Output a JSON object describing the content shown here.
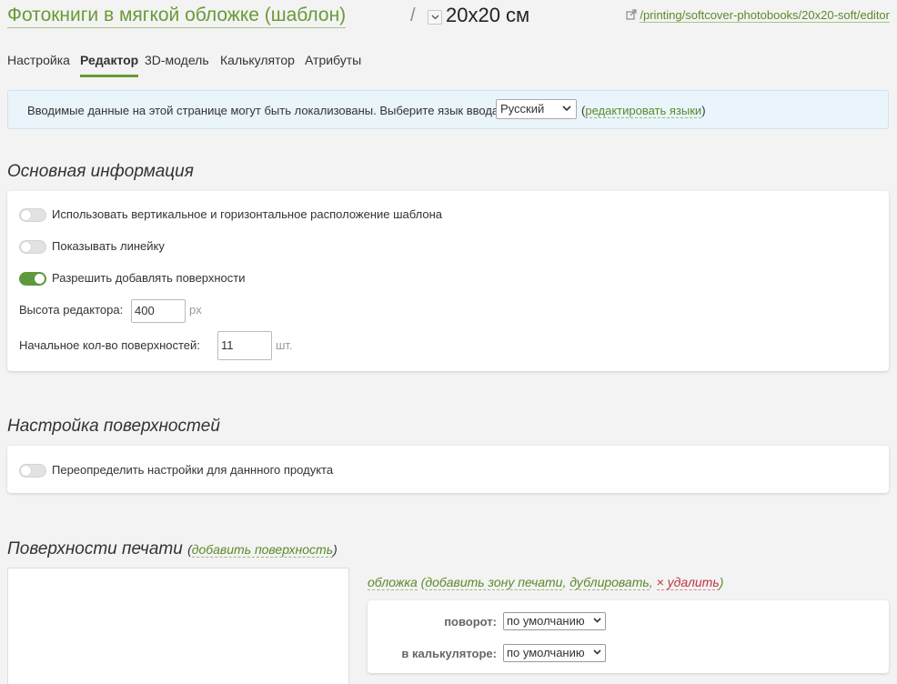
{
  "header": {
    "title": "Фотокниги в мягкой обложке (шаблон)",
    "separator": "/",
    "variant": "20x20 см",
    "url": "/printing/softcover-photobooks/20x20-soft/editor",
    "link_icon": "external-link-icon"
  },
  "tabs": [
    {
      "label": "Настройка",
      "active": false
    },
    {
      "label": "Редактор",
      "active": true
    },
    {
      "label": "3D-модель",
      "active": false
    },
    {
      "label": "Калькулятор",
      "active": false
    },
    {
      "label": "Атрибуты",
      "active": false
    }
  ],
  "notice": {
    "text": "Вводимые данные на этой странице могут быть локализованы. Выберите язык ввода:",
    "language": "Русский",
    "open_paren": "(",
    "edit_link": "редактировать языки",
    "close_paren": ")"
  },
  "main_info": {
    "title": "Основная информация",
    "toggles": [
      {
        "label": "Использовать вертикальное и горизонтальное расположение шаблона",
        "on": false
      },
      {
        "label": "Показывать линейку",
        "on": false
      },
      {
        "label": "Разрешить добавлять поверхности",
        "on": true
      }
    ],
    "editor_height": {
      "label": "Высота редактора:",
      "value": "400",
      "unit": "px"
    },
    "initial_surfaces": {
      "label": "Начальное кол-во поверхностей:",
      "value": "11",
      "unit": "шт."
    }
  },
  "surface_settings": {
    "title": "Настройка поверхностей",
    "toggle": {
      "label": "Переопределить настройки для даннного продукта",
      "on": false
    }
  },
  "print_surfaces": {
    "title": "Поверхности печати",
    "open_paren": "(",
    "add_link": "добавить поверхность",
    "close_paren": ")",
    "surface": {
      "name": "обложка",
      "add_zone": "добавить зону печати",
      "comma": ",",
      "duplicate": "дублировать",
      "delete_prefix": "×",
      "delete": "удалить",
      "props": [
        {
          "label": "поворот:",
          "value": "по умолчанию"
        },
        {
          "label": "в калькуляторе:",
          "value": "по умолчанию"
        }
      ]
    }
  },
  "colors": {
    "accent": "#6a9a37",
    "toggle_on": "#5e9a3b",
    "notice_bg": "#eaf4fb",
    "delete": "#c0333f"
  }
}
